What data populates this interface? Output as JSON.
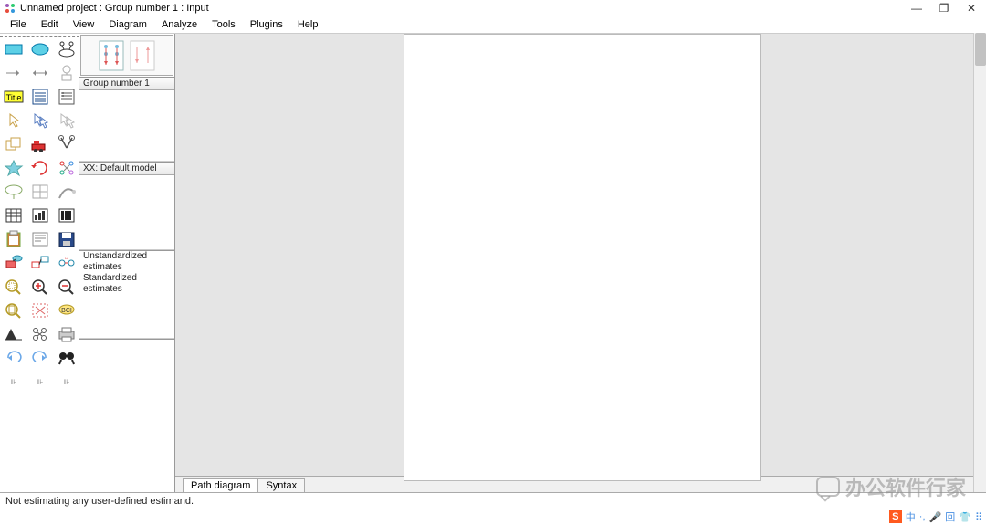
{
  "title": "Unnamed project : Group number 1 : Input",
  "menu": [
    "File",
    "Edit",
    "View",
    "Diagram",
    "Analyze",
    "Tools",
    "Plugins",
    "Help"
  ],
  "panels": {
    "groups": {
      "head": "Group number 1",
      "items": []
    },
    "models": {
      "head": "XX: Default model",
      "items": []
    },
    "estimates": {
      "items": [
        "Unstandardized estimates",
        "Standardized estimates"
      ]
    }
  },
  "tabs": {
    "path": "Path diagram",
    "syntax": "Syntax"
  },
  "status": "Not estimating any user-defined estimand.",
  "watermark": "办公软件行家",
  "tray": {
    "ime_s": "S",
    "ime_lang": "中",
    "sep": "·,",
    "mic": "🎤",
    "sq": "回",
    "shirt": "👕",
    "grid": "⠿"
  },
  "tools": {
    "title_label": "Title"
  }
}
